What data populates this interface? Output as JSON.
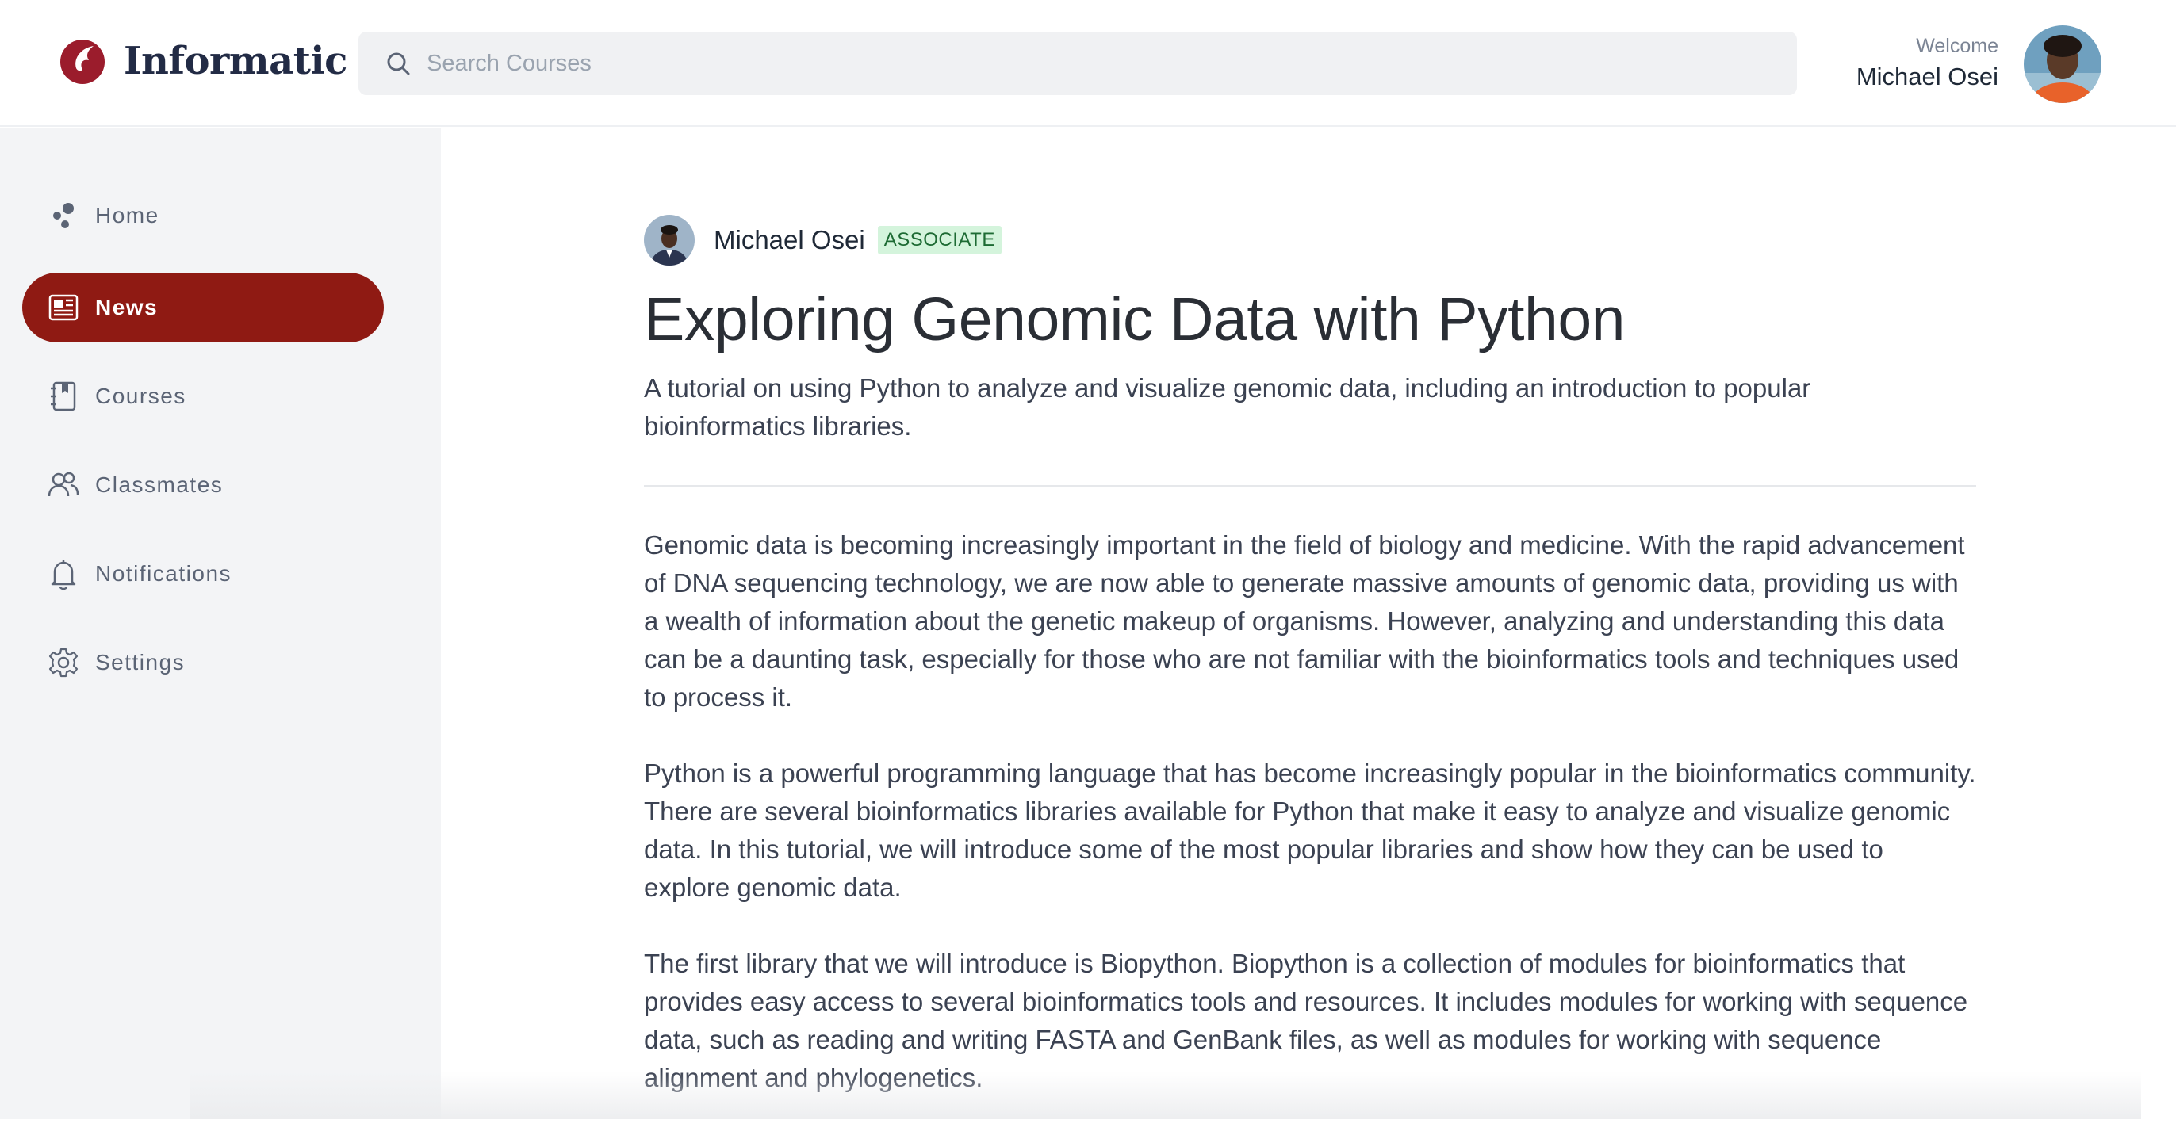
{
  "app": {
    "logo_text": "Informatic",
    "brand_color": "#8f1a13"
  },
  "search": {
    "placeholder": "Search Courses"
  },
  "user": {
    "welcome_label": "Welcome",
    "name": "Michael Osei"
  },
  "sidebar": {
    "items": [
      {
        "label": "Home",
        "icon": "home-icon",
        "active": false
      },
      {
        "label": "News",
        "icon": "news-icon",
        "active": true
      },
      {
        "label": "Courses",
        "icon": "courses-icon",
        "active": false
      },
      {
        "label": "Classmates",
        "icon": "classmates-icon",
        "active": false
      },
      {
        "label": "Notifications",
        "icon": "bell-icon",
        "active": false
      },
      {
        "label": "Settings",
        "icon": "gear-icon",
        "active": false
      }
    ]
  },
  "article": {
    "author": "Michael Osei",
    "badge": "ASSOCIATE",
    "title": "Exploring Genomic Data with Python",
    "subtitle": "A tutorial on using Python to analyze and visualize genomic data, including an introduction to popular bioinformatics libraries.",
    "paragraphs": [
      "Genomic data is becoming increasingly important in the field of biology and medicine. With the rapid advancement of DNA sequencing technology, we are now able to generate massive amounts of genomic data, providing us with a wealth of information about the genetic makeup of organisms. However, analyzing and understanding this data can be a daunting task, especially for those who are not familiar with the bioinformatics tools and techniques used to process it.",
      "Python is a powerful programming language that has become increasingly popular in the bioinformatics community. There are several bioinformatics libraries available for Python that make it easy to analyze and visualize genomic data. In this tutorial, we will introduce some of the most popular libraries and show how they can be used to explore genomic data.",
      "The first library that we will introduce is Biopython. Biopython is a collection of modules for bioinformatics that provides easy access to several bioinformatics tools and resources. It includes modules for working with sequence data, such as reading and writing FASTA and GenBank files, as well as modules for working with sequence alignment and phylogenetics."
    ]
  }
}
